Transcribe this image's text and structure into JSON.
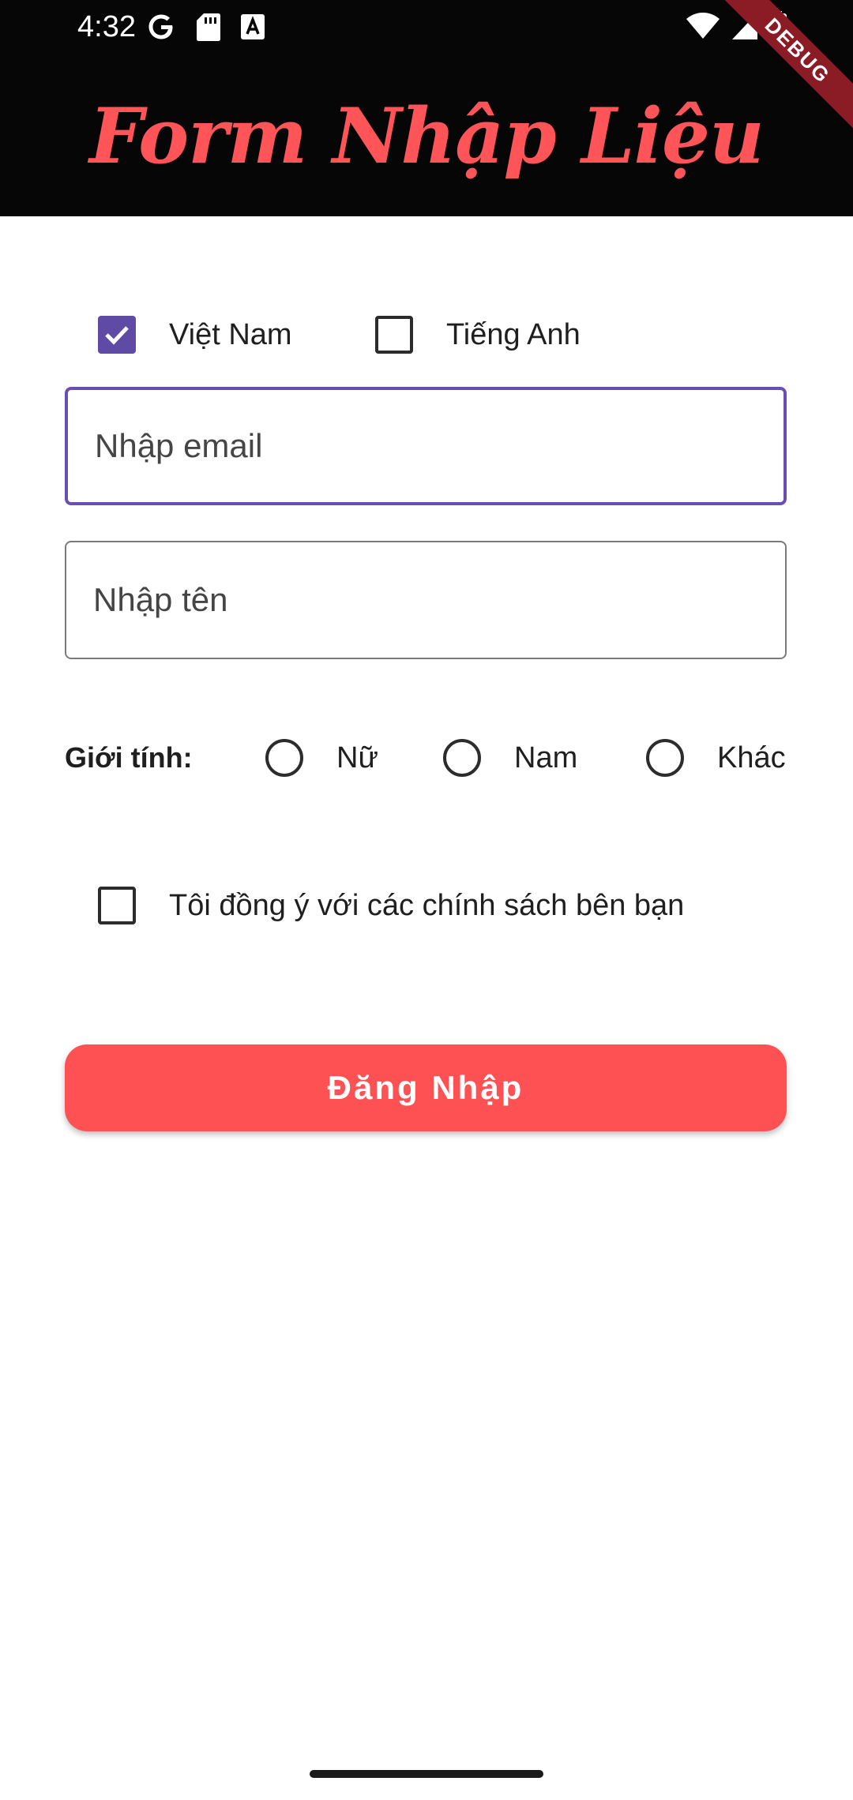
{
  "status_bar": {
    "time": "4:32",
    "left_icons": [
      "google-icon",
      "sd-card-icon",
      "keyboard-a-icon"
    ],
    "right_icons": [
      "wifi-icon",
      "signal-icon",
      "battery-icon"
    ]
  },
  "app_bar": {
    "title": "Form Nhập Liệu",
    "debug_banner": "DEBUG",
    "title_color": "#ff5558",
    "background": "#060606"
  },
  "language": {
    "options": [
      {
        "label": "Việt Nam",
        "checked": true
      },
      {
        "label": "Tiếng Anh",
        "checked": false
      }
    ],
    "checked_color": "#5f4aa6"
  },
  "email": {
    "placeholder": "Nhập email",
    "value": "",
    "focused": true
  },
  "name": {
    "placeholder": "Nhập tên",
    "value": ""
  },
  "gender": {
    "label": "Giới tính:",
    "options": [
      "Nữ",
      "Nam",
      "Khác"
    ],
    "selected": null
  },
  "agreement": {
    "label": "Tôi đồng ý với các chính sách bên bạn",
    "checked": false
  },
  "login_button": {
    "label": "Đăng Nhập",
    "color": "#fe5154"
  }
}
